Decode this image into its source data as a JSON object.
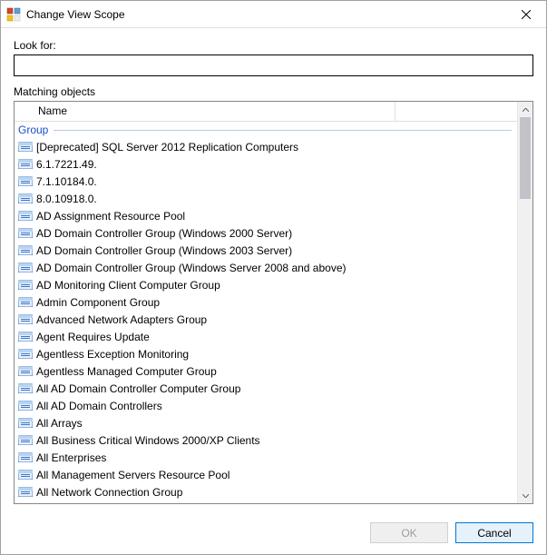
{
  "window": {
    "title": "Change View Scope"
  },
  "labels": {
    "look_for": "Look for:",
    "matching_objects": "Matching objects",
    "name_column": "Name",
    "group_header": "Group"
  },
  "search": {
    "value": ""
  },
  "list": {
    "items": [
      "[Deprecated] SQL Server 2012 Replication Computers",
      "6.1.7221.49.",
      "7.1.10184.0.",
      "8.0.10918.0.",
      "AD Assignment Resource Pool",
      "AD Domain Controller Group (Windows 2000 Server)",
      "AD Domain Controller Group (Windows 2003 Server)",
      "AD Domain Controller Group (Windows Server 2008 and above)",
      "AD Monitoring Client Computer Group",
      "Admin Component Group",
      "Advanced Network Adapters Group",
      "Agent Requires Update",
      "Agentless Exception Monitoring",
      "Agentless Managed Computer Group",
      "All AD Domain Controller Computer Group",
      "All AD Domain Controllers",
      "All Arrays",
      "All Business Critical Windows 2000/XP Clients",
      "All Enterprises",
      "All Management Servers Resource Pool",
      "All Network Connection Group"
    ]
  },
  "buttons": {
    "ok": "OK",
    "cancel": "Cancel"
  }
}
